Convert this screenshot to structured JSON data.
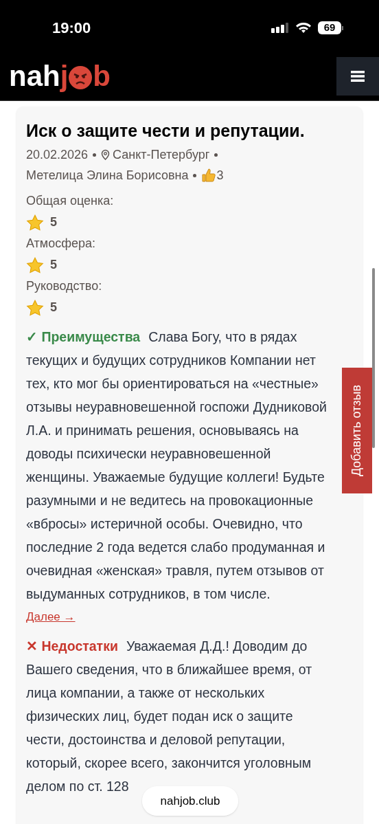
{
  "status_bar": {
    "time": "19:00",
    "battery": "69"
  },
  "header": {
    "logo": {
      "white": "nah",
      "red_before": "j",
      "red_after": "b"
    }
  },
  "review": {
    "title": "Иск о защите чести и репутации.",
    "date": "20.02.2026",
    "city": "Санкт-Петербург",
    "author": "Метелица Элина Борисовна",
    "likes": "3",
    "ratings": [
      {
        "label": "Общая оценка:",
        "value": "5"
      },
      {
        "label": "Атмосфера:",
        "value": "5"
      },
      {
        "label": "Руководство:",
        "value": "5"
      }
    ],
    "sections": [
      {
        "kind": "pros",
        "mark": "✓",
        "label": "Преимущества",
        "text": "Слава Богу, что в рядах текущих и будущих сотрудников Компании нет тех, кто мог бы ориентироваться на «честные» отзывы неуравновешенной госпожи Дудниковой Л.А. и принимать решения, основываясь на доводы психически неуравновешенной женщины. Уважаемые будущие коллеги! Будьте разумными и не ведитесь на провокационные «вбросы» истеричной особы. Очевидно, что последние 2 года ведется слабо продуманная и очевидная «женская» травля, путем отзывов от выдуманных сотрудников, в том числе.",
        "more": "Далее →"
      },
      {
        "kind": "cons",
        "mark": "✕",
        "label": "Недостатки",
        "text": "Уважаемая Д.Д.! Доводим до Вашего сведения, что в ближайшее время, от лица компании, а также от нескольких физических лиц, будет подан иск о защите чести, достоинства и деловой репутации, который, скорее всего, закончится уголовным делом по ст. 128"
      }
    ]
  },
  "side_button": "Добавить отзыв",
  "url_pill": "nahjob.club"
}
